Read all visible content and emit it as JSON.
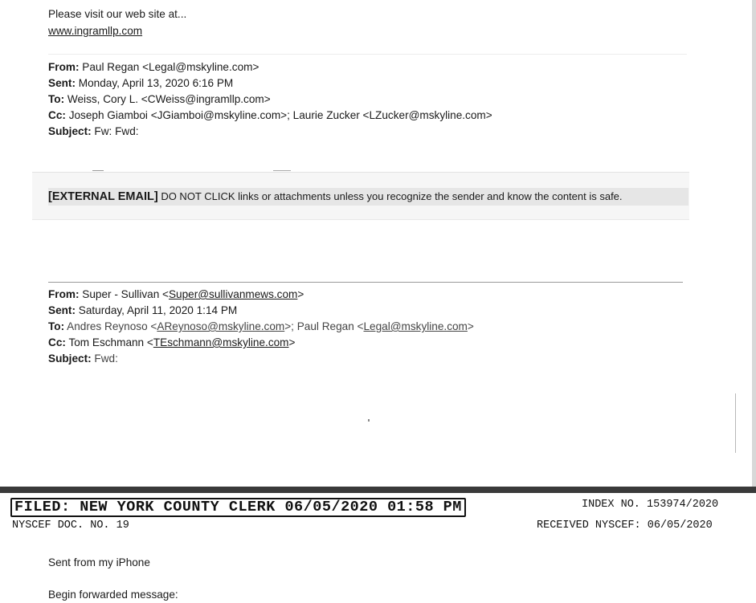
{
  "top_page": {
    "website_intro": "Please visit our web site at...",
    "website_link": "www.ingramllp.com",
    "email1": {
      "from_label": "From:",
      "from_value": "Paul Regan <Legal@mskyline.com>",
      "sent_label": "Sent:",
      "sent_value": "Monday, April 13, 2020 6:16 PM",
      "to_label": "To:",
      "to_value": "Weiss, Cory L. <CWeiss@ingramllp.com>",
      "cc_label": "Cc:",
      "cc_value": "Joseph Giamboi <JGiamboi@mskyline.com>; Laurie Zucker <LZucker@mskyline.com>",
      "subject_label": "Subject:",
      "subject_value": "Fw: Fwd:"
    },
    "banner": {
      "tag": "[EXTERNAL EMAIL]",
      "message": "DO NOT CLICK links or attachments unless you recognize the sender and know the content is safe."
    },
    "email2": {
      "from_label": "From:",
      "from_name": "Super - Sullivan <",
      "from_email": "Super@sullivanmews.com",
      "from_close": ">",
      "sent_label": "Sent:",
      "sent_value": "Saturday, April 11, 2020 1:14 PM",
      "to_label": "To:",
      "to_name1": "Andres Reynoso <",
      "to_email1": "AReynoso@mskyline.com",
      "to_mid": ">; Paul Regan <",
      "to_email2": "Legal@mskyline.com",
      "to_close": ">",
      "cc_label": "Cc:",
      "cc_name": "Tom Eschmann <",
      "cc_email": "TEschmann@mskyline.com",
      "cc_close": ">",
      "subject_label": "Subject:",
      "subject_value": "Fwd:"
    }
  },
  "filing_header": {
    "filed_stamp": "FILED: NEW YORK COUNTY CLERK 06/05/2020 01:58 PM",
    "index_no": "INDEX NO. 153974/2020",
    "doc_no": "NYSCEF DOC. NO. 19",
    "received": "RECEIVED NYSCEF: 06/05/2020"
  },
  "bottom_page": {
    "sent_from": "Sent from my iPhone",
    "begin_forwarded": "Begin forwarded message:"
  }
}
